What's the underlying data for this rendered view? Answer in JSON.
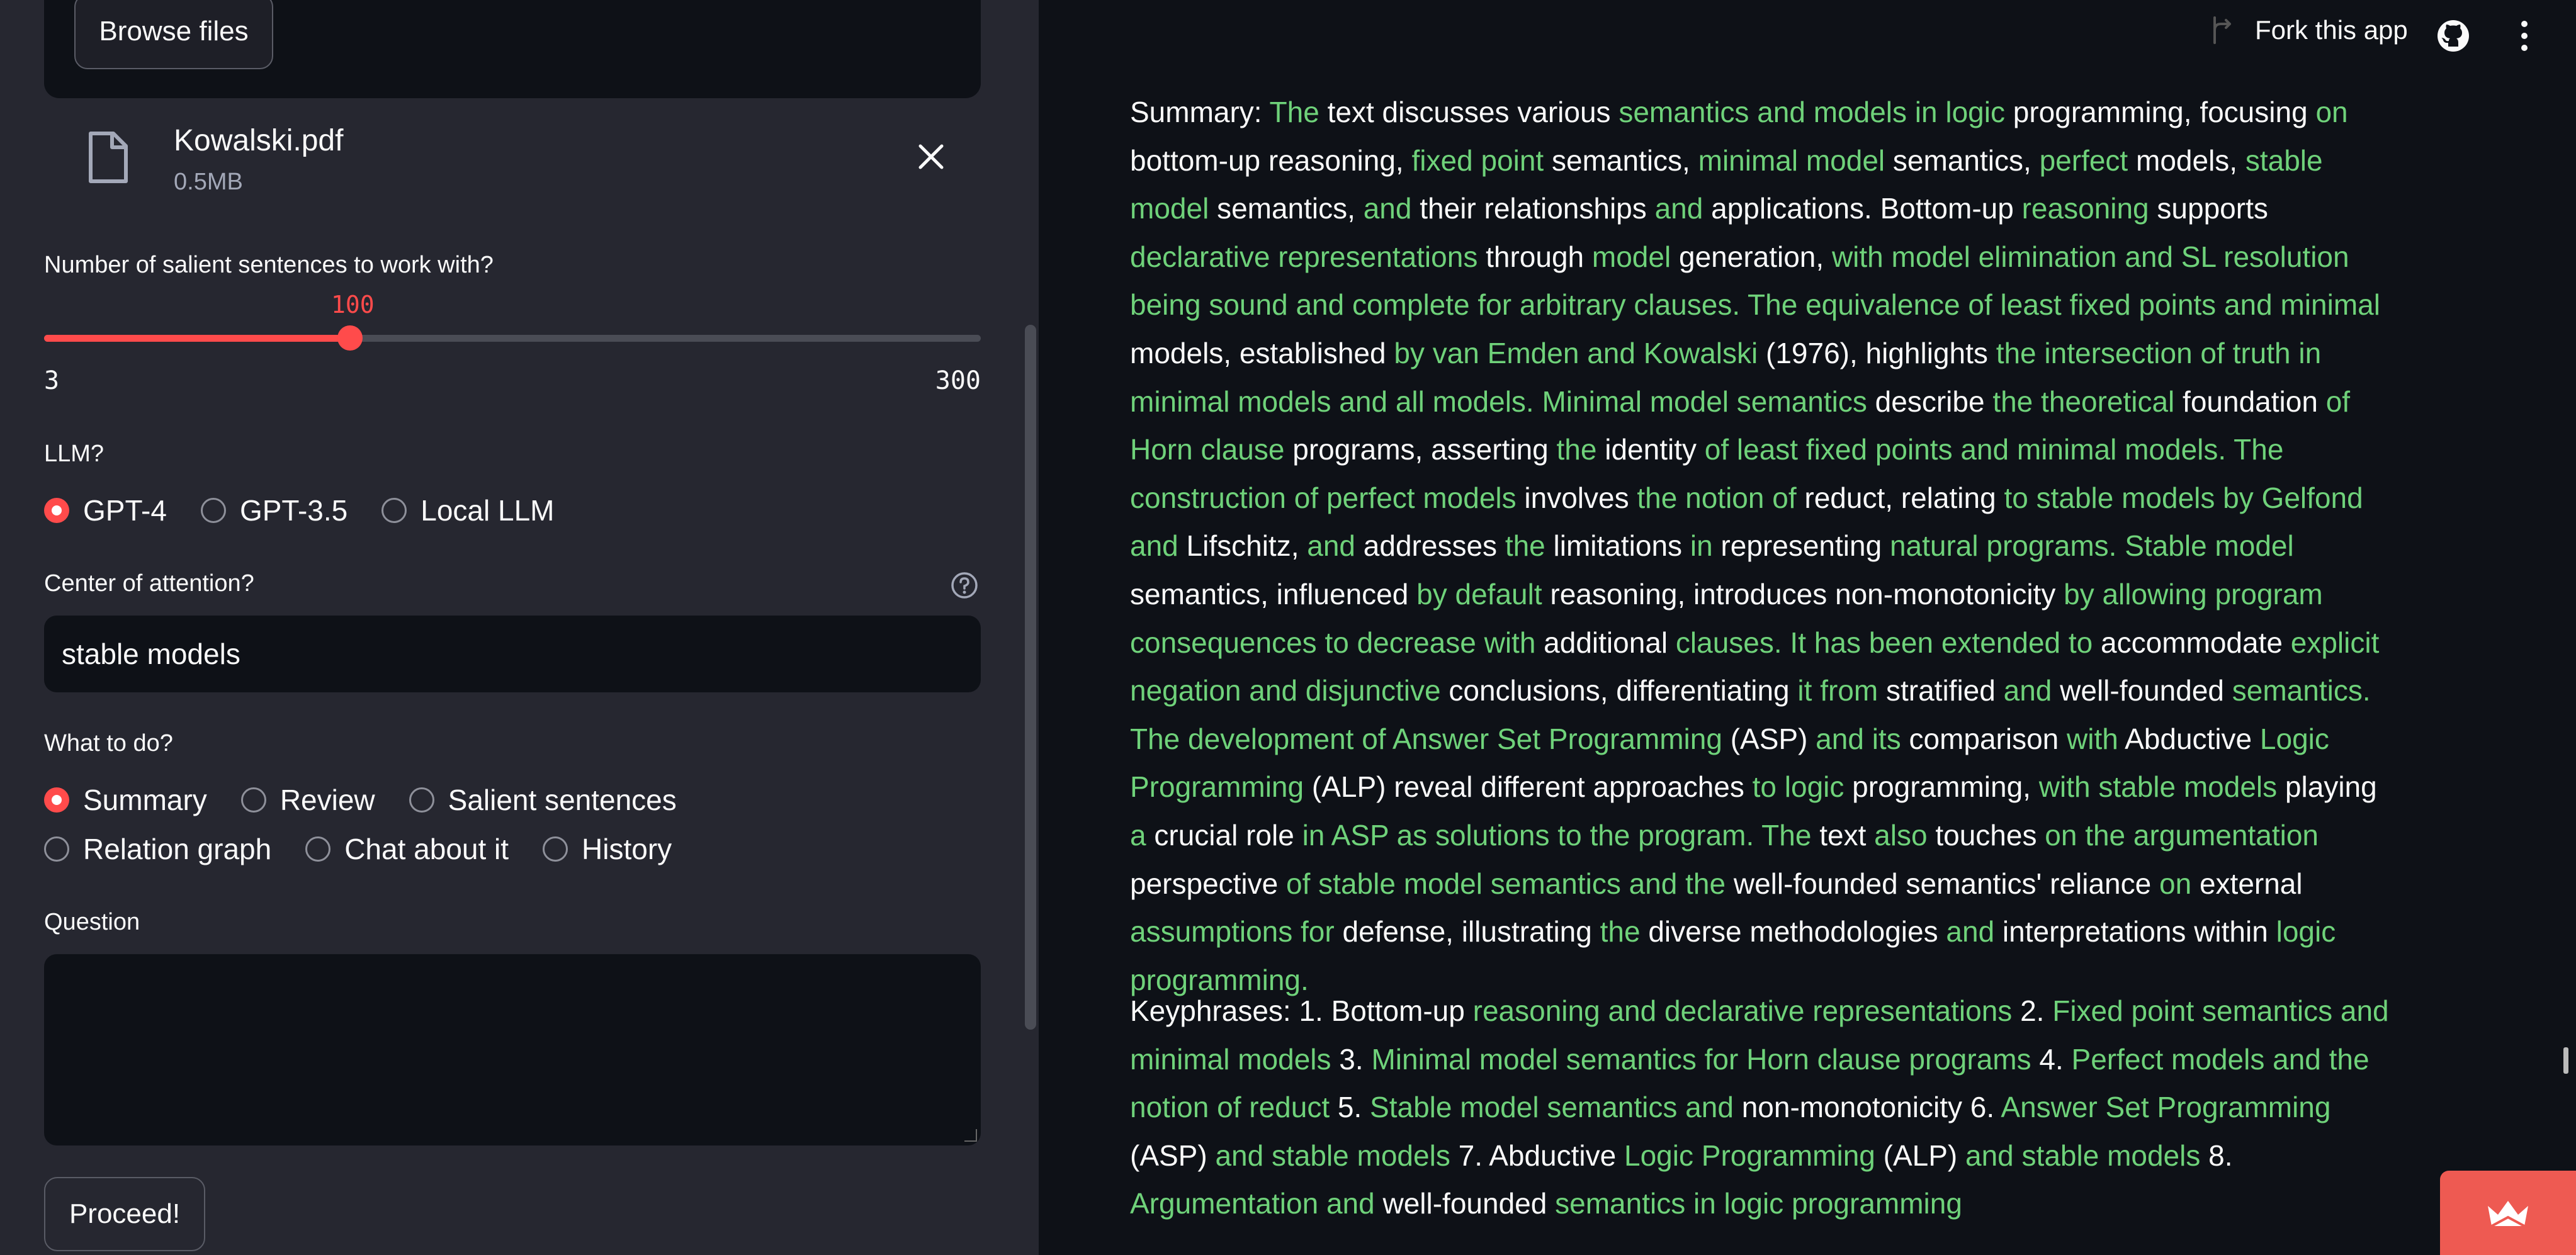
{
  "sidebar": {
    "upload": {
      "browse_label": "Browse files",
      "file_name": "Kowalski.pdf",
      "file_size": "0.5MB"
    },
    "slider": {
      "label": "Number of salient sentences to work with?",
      "value": "100",
      "value_num": 100,
      "min": "3",
      "min_num": 3,
      "max": "300",
      "max_num": 300
    },
    "llm": {
      "label": "LLM?",
      "options": [
        "GPT-4",
        "GPT-3.5",
        "Local LLM"
      ],
      "selected": "GPT-4"
    },
    "center_of_attention": {
      "label": "Center of attention?",
      "value": "stable models"
    },
    "what_to_do": {
      "label": "What to do?",
      "options": [
        "Summary",
        "Review",
        "Salient sentences",
        "Relation graph",
        "Chat about it",
        "History"
      ],
      "selected": "Summary"
    },
    "question": {
      "label": "Question",
      "value": ""
    },
    "proceed_label": "Proceed!"
  },
  "header": {
    "fork_label": "Fork this app"
  },
  "colors": {
    "accent": "#ff4b4b",
    "highlight": "#6fd27a",
    "sidebar_bg": "#262730",
    "main_bg": "#0e1117"
  },
  "output": {
    "summary": [
      [
        "Summary: ",
        0
      ],
      [
        "The",
        1
      ],
      [
        " text discusses various ",
        0
      ],
      [
        "semantics and models in logic",
        1
      ],
      [
        " programming, focusing ",
        0
      ],
      [
        "on",
        1
      ],
      [
        " bottom-up reasoning, ",
        0
      ],
      [
        "fixed point",
        1
      ],
      [
        " semantics, ",
        0
      ],
      [
        "minimal model",
        1
      ],
      [
        " semantics, ",
        0
      ],
      [
        "perfect",
        1
      ],
      [
        " models, ",
        0
      ],
      [
        "stable model",
        1
      ],
      [
        " semantics, ",
        0
      ],
      [
        "and",
        1
      ],
      [
        " their relationships ",
        0
      ],
      [
        "and",
        1
      ],
      [
        " applications. Bottom-up ",
        0
      ],
      [
        "reasoning",
        1
      ],
      [
        " supports ",
        0
      ],
      [
        "declarative representations",
        1
      ],
      [
        " through ",
        0
      ],
      [
        "model",
        1
      ],
      [
        " generation, ",
        0
      ],
      [
        "with model elimination and SL resolution being sound and complete for arbitrary clauses. The equivalence of least fixed points and minimal",
        1
      ],
      [
        " models, established ",
        0
      ],
      [
        "by van Emden and Kowalski",
        1
      ],
      [
        " (1976), highlights ",
        0
      ],
      [
        "the intersection of truth in minimal models and all models. Minimal model semantics",
        1
      ],
      [
        " describe ",
        0
      ],
      [
        "the theoretical",
        1
      ],
      [
        " foundation ",
        0
      ],
      [
        "of Horn clause",
        1
      ],
      [
        " programs, asserting ",
        0
      ],
      [
        "the",
        1
      ],
      [
        " identity ",
        0
      ],
      [
        "of least fixed points and minimal models. The construction of perfect models",
        1
      ],
      [
        " involves ",
        0
      ],
      [
        "the notion of",
        1
      ],
      [
        " reduct, relating ",
        0
      ],
      [
        "to stable models by Gelfond and",
        1
      ],
      [
        " Lifschitz, ",
        0
      ],
      [
        "and",
        1
      ],
      [
        " addresses ",
        0
      ],
      [
        "the",
        1
      ],
      [
        " limitations ",
        0
      ],
      [
        "in",
        1
      ],
      [
        " representing ",
        0
      ],
      [
        "natural programs. Stable model",
        1
      ],
      [
        " semantics, influenced ",
        0
      ],
      [
        "by default",
        1
      ],
      [
        " reasoning, introduces non-monotonicity ",
        0
      ],
      [
        "by allowing program consequences to decrease with",
        1
      ],
      [
        " additional ",
        0
      ],
      [
        "clauses. It has been extended to",
        1
      ],
      [
        " accommodate ",
        0
      ],
      [
        "explicit negation and disjunctive",
        1
      ],
      [
        " conclusions, differentiating ",
        0
      ],
      [
        "it from",
        1
      ],
      [
        " stratified ",
        0
      ],
      [
        "and",
        1
      ],
      [
        " well-founded ",
        0
      ],
      [
        "semantics. The development of Answer Set Programming",
        1
      ],
      [
        " (ASP) ",
        0
      ],
      [
        "and its",
        1
      ],
      [
        " comparison ",
        0
      ],
      [
        "with",
        1
      ],
      [
        " Abductive ",
        0
      ],
      [
        "Logic Programming",
        1
      ],
      [
        " (ALP) reveal different approaches ",
        0
      ],
      [
        "to logic",
        1
      ],
      [
        " programming, ",
        0
      ],
      [
        "with stable models",
        1
      ],
      [
        " playing ",
        0
      ],
      [
        "a",
        1
      ],
      [
        " crucial role ",
        0
      ],
      [
        "in ASP as solutions to the program. The",
        1
      ],
      [
        " text ",
        0
      ],
      [
        "also",
        1
      ],
      [
        " touches ",
        0
      ],
      [
        "on the argumentation",
        1
      ],
      [
        " perspective ",
        0
      ],
      [
        "of stable model semantics and the",
        1
      ],
      [
        " well-founded semantics' reliance ",
        0
      ],
      [
        "on",
        1
      ],
      [
        " external ",
        0
      ],
      [
        "assumptions for",
        1
      ],
      [
        " defense, illustrating ",
        0
      ],
      [
        "the",
        1
      ],
      [
        " diverse methodologies ",
        0
      ],
      [
        "and",
        1
      ],
      [
        " interpretations within ",
        0
      ],
      [
        "logic programming.",
        1
      ]
    ],
    "keyphrases": [
      [
        "Keyphrases: 1. Bottom-up ",
        0
      ],
      [
        "reasoning and declarative representations",
        1
      ],
      [
        " 2. ",
        0
      ],
      [
        "Fixed point semantics and minimal models",
        1
      ],
      [
        " 3. ",
        0
      ],
      [
        "Minimal model semantics for Horn clause programs",
        1
      ],
      [
        " 4. ",
        0
      ],
      [
        "Perfect models and the notion of reduct",
        1
      ],
      [
        " 5. ",
        0
      ],
      [
        "Stable model semantics and",
        1
      ],
      [
        " non-monotonicity 6. ",
        0
      ],
      [
        "Answer Set Programming",
        1
      ],
      [
        " (ASP) ",
        0
      ],
      [
        "and stable models",
        1
      ],
      [
        " 7. Abductive ",
        0
      ],
      [
        "Logic Programming",
        1
      ],
      [
        " (ALP) ",
        0
      ],
      [
        "and stable models",
        1
      ],
      [
        " 8. ",
        0
      ],
      [
        "Argumentation and",
        1
      ],
      [
        " well-founded ",
        0
      ],
      [
        "semantics in logic programming",
        1
      ]
    ]
  }
}
